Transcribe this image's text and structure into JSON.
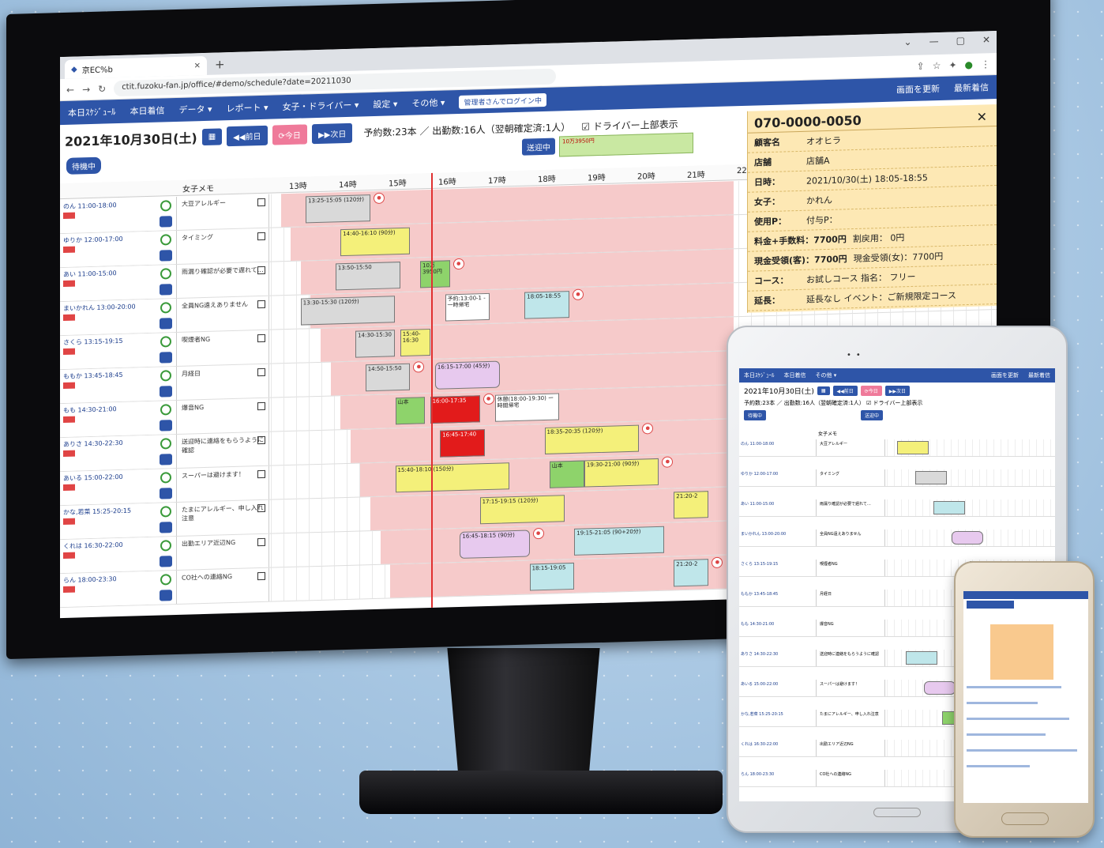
{
  "browser": {
    "tab_title": "京EC%b",
    "url": "ctit.fuzoku-fan.jp/office/#demo/schedule?date=20211030"
  },
  "nav": {
    "items": [
      "本日ｽｹｼﾞｭｰﾙ",
      "本日着信",
      "データ ▾",
      "レポート ▾",
      "女子・ドライバー ▾",
      "設定 ▾",
      "その他 ▾"
    ],
    "login_badge": "管理者さんでログイン中",
    "refresh": "画面を更新",
    "latest": "最新着信"
  },
  "toolbar": {
    "date": "2021年10月30日(土)",
    "prev": "◀◀前日",
    "today": "⟳今日",
    "next": "▶▶次日",
    "summary": "予約数:23本 ／ 出勤数:16人（翌朝確定済:1人）",
    "driver_toggle": "☑ ドライバー上部表示",
    "status": "待機中",
    "sending": "送迎中",
    "mini_band_text": "10万3950円"
  },
  "grid": {
    "memo_header": "女子メモ",
    "hours": [
      "13時",
      "14時",
      "15時",
      "16時",
      "17時",
      "18時",
      "19時",
      "20時",
      "21時",
      "22"
    ],
    "rows": [
      {
        "name": "のん 11:00-18:00",
        "memo": "大豆アレルギー"
      },
      {
        "name": "ゆりか 12:00-17:00",
        "memo": "タイミング"
      },
      {
        "name": "あい 11:00-15:00",
        "memo": "雨漏り確認が必要で遅れて…"
      },
      {
        "name": "まいかれん 13:00-20:00",
        "memo": "全員NG遠えありません"
      },
      {
        "name": "さくら 13:15-19:15",
        "memo": "喫煙者NG"
      },
      {
        "name": "ももか 13:45-18:45",
        "memo": "月経日"
      },
      {
        "name": "もも 14:30-21:00",
        "memo": "爆音NG"
      },
      {
        "name": "ありさ 14:30-22:30",
        "memo": "送迎時に連絡をもらうように確認"
      },
      {
        "name": "あいる 15:00-22:00",
        "memo": "スーパーは避けます！"
      },
      {
        "name": "かな,若菜 15:25-20:15",
        "memo": "たまにアレルギー、申し入れ注意"
      },
      {
        "name": "くれは 16:30-22:00",
        "memo": "出勤エリア近辺NG"
      },
      {
        "name": "らん 18:00-23:30",
        "memo": "CO社への連絡NG"
      }
    ],
    "bookings": [
      {
        "row": 0,
        "start": 13.7,
        "end": 15.0,
        "cls": "g",
        "text": "13:25-15:05 (120分)"
      },
      {
        "row": 1,
        "start": 14.4,
        "end": 15.8,
        "cls": "y",
        "text": "14:40-16:10 (90分)"
      },
      {
        "row": 2,
        "start": 14.3,
        "end": 15.6,
        "cls": "g",
        "text": "13:50-15:50"
      },
      {
        "row": 2,
        "start": 16.0,
        "end": 16.6,
        "cls": "gr",
        "text": "10万3950円"
      },
      {
        "row": 3,
        "start": 13.6,
        "end": 15.5,
        "cls": "g",
        "text": "13:30-15:30 (120分)"
      },
      {
        "row": 3,
        "start": 16.5,
        "end": 17.4,
        "cls": "w",
        "text": "予約:13:00-1 -一時帰宅"
      },
      {
        "row": 3,
        "start": 18.1,
        "end": 19.0,
        "cls": "c",
        "text": "18:05-18:55"
      },
      {
        "row": 4,
        "start": 14.7,
        "end": 15.5,
        "cls": "g",
        "text": "14:30-15:30"
      },
      {
        "row": 4,
        "start": 15.6,
        "end": 16.2,
        "cls": "y",
        "text": "15:40-16:30"
      },
      {
        "row": 5,
        "start": 14.9,
        "end": 15.8,
        "cls": "g",
        "text": "14:50-15:50"
      },
      {
        "row": 5,
        "start": 16.3,
        "end": 17.6,
        "cls": "p",
        "text": "16:15-17:00 (45分)"
      },
      {
        "row": 6,
        "start": 15.5,
        "end": 16.1,
        "cls": "gr",
        "text": "山本"
      },
      {
        "row": 6,
        "start": 16.2,
        "end": 17.2,
        "cls": "r",
        "text": "16:00-17:35"
      },
      {
        "row": 6,
        "start": 17.5,
        "end": 18.8,
        "cls": "w",
        "text": "休憩(18:00-19:30) ー時間帰宅"
      },
      {
        "row": 7,
        "start": 16.4,
        "end": 17.3,
        "cls": "r",
        "text": "16:45-17:40"
      },
      {
        "row": 7,
        "start": 18.5,
        "end": 20.4,
        "cls": "y",
        "text": "18:35-20:35 (120分)"
      },
      {
        "row": 8,
        "start": 15.5,
        "end": 17.8,
        "cls": "y",
        "text": "15:40-18:10 (150分)"
      },
      {
        "row": 8,
        "start": 18.6,
        "end": 19.3,
        "cls": "gr",
        "text": "山本"
      },
      {
        "row": 8,
        "start": 19.3,
        "end": 20.8,
        "cls": "y",
        "text": "19:30-21:00 (90分)"
      },
      {
        "row": 9,
        "start": 17.2,
        "end": 18.9,
        "cls": "y",
        "text": "17:15-19:15 (120分)"
      },
      {
        "row": 9,
        "start": 21.1,
        "end": 21.8,
        "cls": "y",
        "text": "21:20-2"
      },
      {
        "row": 10,
        "start": 16.8,
        "end": 18.2,
        "cls": "p",
        "text": "16:45-18:15 (90分)"
      },
      {
        "row": 10,
        "start": 19.1,
        "end": 20.9,
        "cls": "c",
        "text": "19:15-21:05 (90+20分)"
      },
      {
        "row": 11,
        "start": 18.2,
        "end": 19.1,
        "cls": "c",
        "text": "18:15-19:05"
      },
      {
        "row": 11,
        "start": 21.1,
        "end": 21.8,
        "cls": "c",
        "text": "21:20-2"
      }
    ]
  },
  "detail": {
    "phone": "070-0000-0050",
    "close": "✕",
    "fields": [
      {
        "k": "顧客名",
        "v": "オオヒラ"
      },
      {
        "k": "店舗",
        "v": "店舗A"
      },
      {
        "k": "日時：",
        "v": "2021/10/30(土) 18:05-18:55"
      },
      {
        "k": "女子：",
        "v": "かれん"
      },
      {
        "k": "使用P：",
        "v": "付与P："
      },
      {
        "k": "料金+手数料：7700円",
        "v": "割戻用：  0円"
      },
      {
        "k": "現金受領(客)：7700円",
        "v": "現金受領(女)：7700円"
      },
      {
        "k": "コース：",
        "v": "お試しコース  指名：  フリー"
      },
      {
        "k": "延長：",
        "v": "延長なし  イベント：ご新規限定コース"
      }
    ]
  },
  "tablet": {
    "nav": [
      "本日ｽｹｼﾞｭｰﾙ",
      "本日着信",
      "その他 ▾",
      "画面を更新",
      "最新着信"
    ],
    "date": "2021年10月30日(土)",
    "prev": "◀◀前日",
    "today": "⟳今日",
    "next": "▶▶次日",
    "summary": "予約数:23本 ／ 出勤数:16人（翌朝確定済:1人） ☑ ドライバー上部表示",
    "status": "待機中",
    "sending": "送迎中",
    "memo_header": "女子メモ"
  }
}
